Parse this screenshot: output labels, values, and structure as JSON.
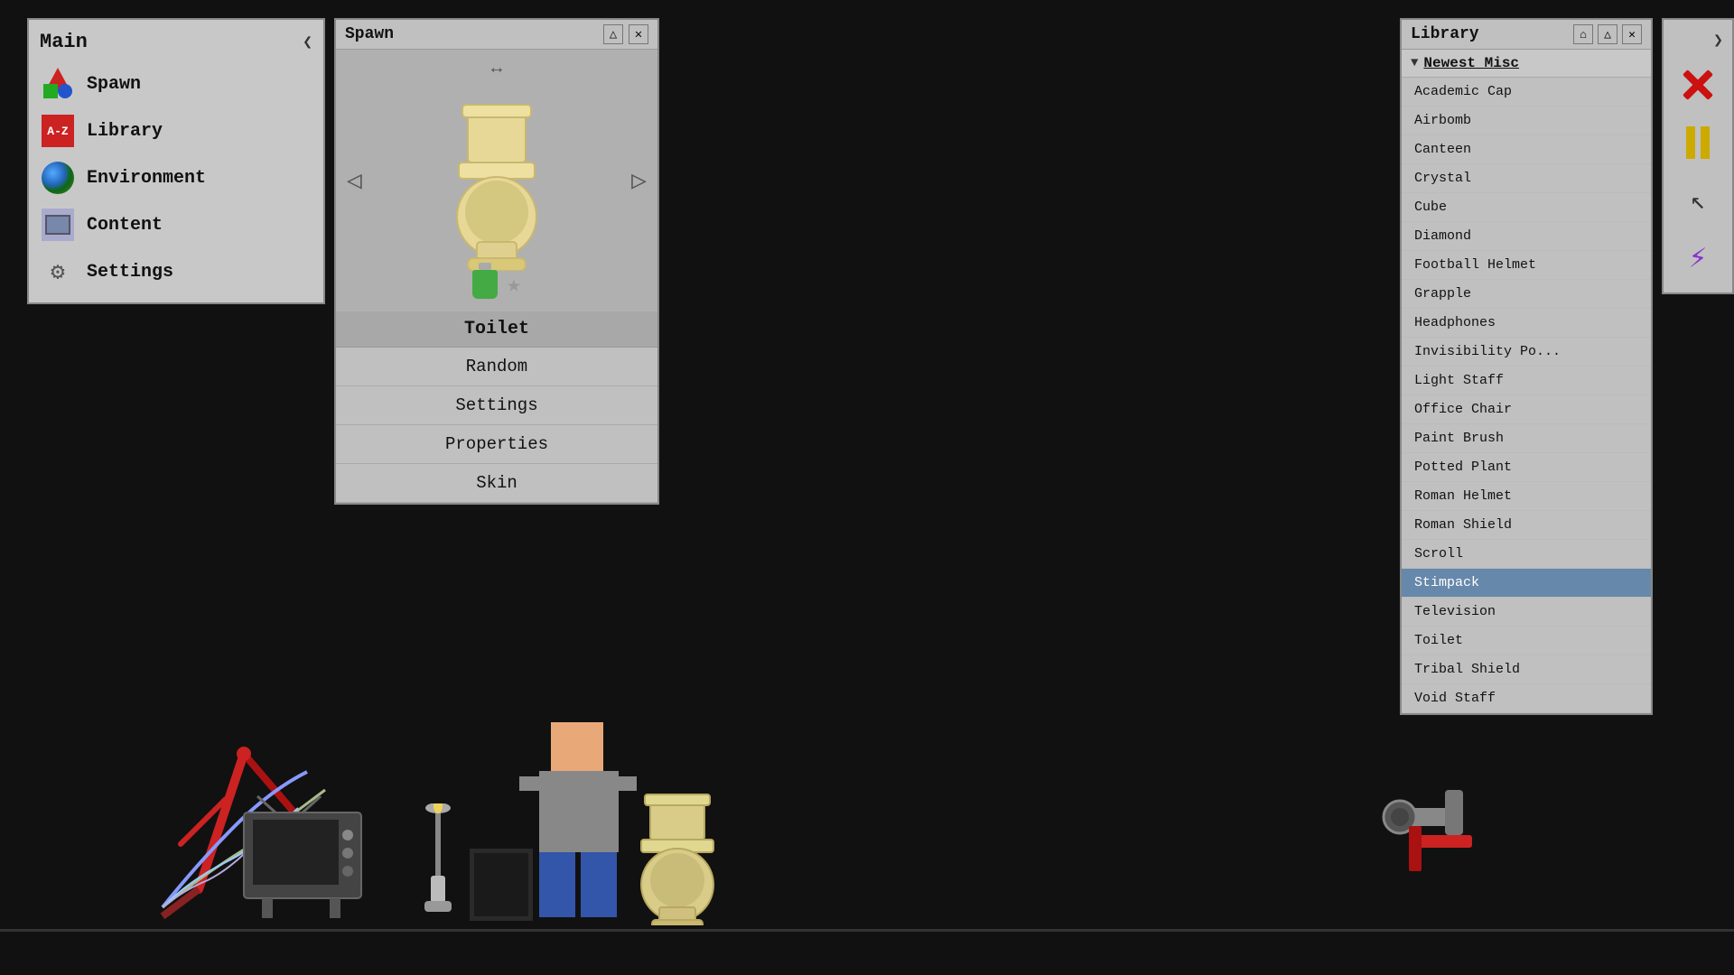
{
  "mainPanel": {
    "title": "Main",
    "collapseBtn": "❮",
    "items": [
      {
        "id": "spawn",
        "label": "Spawn"
      },
      {
        "id": "library",
        "label": "Library"
      },
      {
        "id": "environment",
        "label": "Environment"
      },
      {
        "id": "content",
        "label": "Content"
      },
      {
        "id": "settings",
        "label": "Settings"
      }
    ]
  },
  "spawnPanel": {
    "title": "Spawn",
    "minBtn": "—",
    "maxBtn": "△",
    "closeBtn": "✕",
    "resizeIcon": "↔",
    "currentItem": "Toilet",
    "navLeft": "◁",
    "navRight": "▷",
    "actions": [
      {
        "id": "random",
        "label": "Random"
      },
      {
        "id": "settings",
        "label": "Settings"
      },
      {
        "id": "properties",
        "label": "Properties"
      },
      {
        "id": "skin",
        "label": "Skin"
      }
    ]
  },
  "libraryPanel": {
    "title": "Library",
    "homeIcon": "⌂",
    "minBtn": "△",
    "closeBtn": "✕",
    "categoryName": "Newest Misc",
    "categoryArrow": "▼",
    "items": [
      {
        "id": "academic-cap",
        "label": "Academic Cap",
        "selected": false
      },
      {
        "id": "airbomb",
        "label": "Airbomb",
        "selected": false
      },
      {
        "id": "canteen",
        "label": "Canteen",
        "selected": false
      },
      {
        "id": "crystal",
        "label": "Crystal",
        "selected": false
      },
      {
        "id": "cube",
        "label": "Cube",
        "selected": false
      },
      {
        "id": "diamond",
        "label": "Diamond",
        "selected": false
      },
      {
        "id": "football-helmet",
        "label": "Football Helmet",
        "selected": false
      },
      {
        "id": "grapple",
        "label": "Grapple",
        "selected": false
      },
      {
        "id": "headphones",
        "label": "Headphones",
        "selected": false
      },
      {
        "id": "invisibility-potion",
        "label": "Invisibility Po...",
        "selected": false
      },
      {
        "id": "light-staff",
        "label": "Light Staff",
        "selected": false
      },
      {
        "id": "office-chair",
        "label": "Office Chair",
        "selected": false
      },
      {
        "id": "paint-brush",
        "label": "Paint Brush",
        "selected": false
      },
      {
        "id": "potted-plant",
        "label": "Potted Plant",
        "selected": false
      },
      {
        "id": "roman-helmet",
        "label": "Roman Helmet",
        "selected": false
      },
      {
        "id": "roman-shield",
        "label": "Roman Shield",
        "selected": false
      },
      {
        "id": "scroll",
        "label": "Scroll",
        "selected": false
      },
      {
        "id": "stimpack",
        "label": "Stimpack",
        "selected": true
      },
      {
        "id": "television",
        "label": "Television",
        "selected": false
      },
      {
        "id": "toilet",
        "label": "Toilet",
        "selected": false
      },
      {
        "id": "tribal-shield",
        "label": "Tribal Shield",
        "selected": false
      },
      {
        "id": "void-staff",
        "label": "Void Staff",
        "selected": false
      }
    ]
  },
  "rightToolbar": {
    "collapseBtn": "❯",
    "buttons": [
      {
        "id": "close",
        "label": "✕"
      },
      {
        "id": "pause",
        "label": "||"
      },
      {
        "id": "cursor",
        "label": "cursor"
      },
      {
        "id": "lightning",
        "label": "⚡"
      }
    ]
  }
}
